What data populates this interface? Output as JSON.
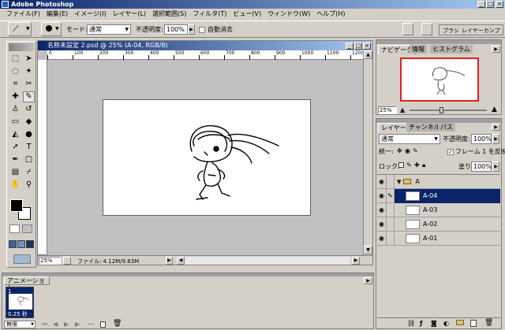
{
  "app": {
    "title": "Adobe Photoshop"
  },
  "menu": [
    "ファイル(F)",
    "編集(E)",
    "イメージ(I)",
    "レイヤー(L)",
    "選択範囲(S)",
    "フィルタ(T)",
    "ビュー(V)",
    "ウィンドウ(W)",
    "ヘルプ(H)"
  ],
  "options": {
    "mode_label": "モード:",
    "mode_value": "通常",
    "opacity_label": "不透明度:",
    "opacity_value": "100%",
    "auto_erase_label": "自動消去",
    "palette_well_tab": "ブラシ",
    "palette_well_tab2": "レイヤーカンプ"
  },
  "document": {
    "title": "名称未設定 2.psd @ 25% (A-04, RGB/8)",
    "zoom": "25%",
    "file_info": "ファイル: 4.12M/9.63M",
    "ruler_ticks": [
      "0",
      "100",
      "200",
      "300",
      "400",
      "500",
      "600",
      "700",
      "800",
      "900",
      "1000",
      "1100",
      "1200"
    ]
  },
  "navigator": {
    "tabs": [
      "ナビゲータ",
      "情報",
      "ヒストグラム"
    ],
    "zoom": "25%"
  },
  "layers": {
    "tabs": [
      "レイヤー",
      "チャンネル",
      "パス"
    ],
    "blend_mode": "通常",
    "opacity_label": "不透明度:",
    "opacity_value": "100%",
    "unify_label": "統一:",
    "frame1_label": "フレーム 1 を反映",
    "lock_label": "ロック:",
    "fill_label": "塗り:",
    "fill_value": "100%",
    "group_name": "A",
    "items": [
      {
        "name": "A-04",
        "selected": true
      },
      {
        "name": "A-03",
        "selected": false
      },
      {
        "name": "A-02",
        "selected": false
      },
      {
        "name": "A-01",
        "selected": false
      }
    ]
  },
  "animation": {
    "title": "アニメーション",
    "frame_number": "1",
    "frame_delay": "0.25 秒",
    "loop": "無限"
  },
  "colors": {
    "accent": "#0a246a",
    "selected_layer": "#0a246a",
    "navigator_box": "#e02020"
  }
}
